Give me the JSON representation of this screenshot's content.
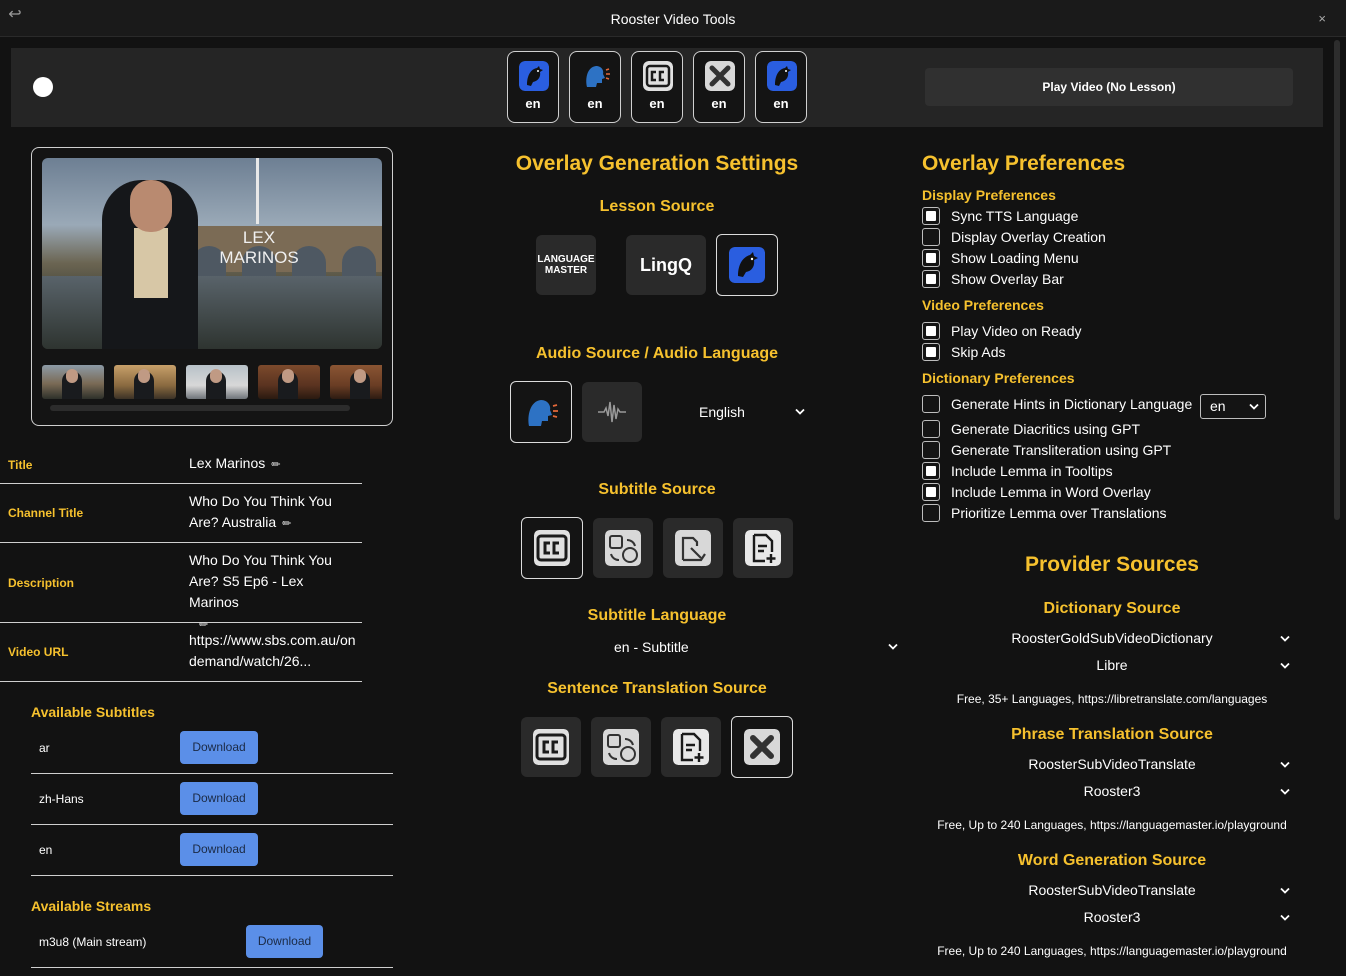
{
  "window": {
    "title": "Rooster Video Tools",
    "back_icon": "↩",
    "close_icon": "×"
  },
  "toolbar": {
    "buttons": [
      {
        "icon": "rooster-icon",
        "label": "en"
      },
      {
        "icon": "speaking-head-icon",
        "label": "en"
      },
      {
        "icon": "closed-captions-icon",
        "label": "en"
      },
      {
        "icon": "close-x-icon",
        "label": "en"
      },
      {
        "icon": "rooster-icon",
        "label": "en"
      }
    ],
    "play_label": "Play Video (No Lesson)"
  },
  "video": {
    "caption_line1": "LEX",
    "caption_line2": "MARINOS"
  },
  "metadata": [
    {
      "key": "Title",
      "value": "Lex Marinos"
    },
    {
      "key": "Channel Title",
      "value": "Who Do You Think You Are? Australia"
    },
    {
      "key": "Description",
      "value": "Who Do You Think You Are? S5 Ep6 - Lex Marinos"
    },
    {
      "key": "Video URL",
      "value": "https://www.sbs.com.au/ondemand/watch/26..."
    }
  ],
  "subtitles": {
    "heading": "Available Subtitles",
    "items": [
      {
        "lang": "ar",
        "button": "Download"
      },
      {
        "lang": "zh-Hans",
        "button": "Download"
      },
      {
        "lang": "en",
        "button": "Download"
      }
    ]
  },
  "streams": {
    "heading": "Available Streams",
    "items": [
      {
        "name": "m3u8 (Main stream)",
        "button": "Download"
      }
    ]
  },
  "overlay_settings": {
    "title": "Overlay Generation Settings",
    "lesson_source": {
      "heading": "Lesson Source",
      "language_master_line1": "LANGUAGE",
      "language_master_line2": "MASTER",
      "lingq": "LingQ"
    },
    "audio": {
      "heading": "Audio Source / Audio Language",
      "language": "English"
    },
    "subtitle_source": {
      "heading": "Subtitle Source"
    },
    "subtitle_language": {
      "heading": "Subtitle Language",
      "value": "en - Subtitle"
    },
    "sentence_translation": {
      "heading": "Sentence Translation Source"
    }
  },
  "overlay_prefs": {
    "title": "Overlay Preferences",
    "display": {
      "heading": "Display Preferences",
      "items": [
        {
          "label": "Sync TTS Language",
          "checked": true
        },
        {
          "label": "Display Overlay Creation",
          "checked": false
        },
        {
          "label": "Show Loading Menu",
          "checked": true
        },
        {
          "label": "Show Overlay Bar",
          "checked": true
        }
      ]
    },
    "video": {
      "heading": "Video Preferences",
      "items": [
        {
          "label": "Play Video on Ready",
          "checked": true
        },
        {
          "label": "Skip Ads",
          "checked": true
        }
      ]
    },
    "dictionary": {
      "heading": "Dictionary Preferences",
      "hint_lang": "en",
      "items": [
        {
          "label": "Generate Hints in Dictionary Language",
          "checked": false
        },
        {
          "label": "Generate Diacritics using GPT",
          "checked": false
        },
        {
          "label": "Generate Transliteration using GPT",
          "checked": false
        },
        {
          "label": "Include Lemma in Tooltips",
          "checked": true
        },
        {
          "label": "Include Lemma in Word Overlay",
          "checked": true
        },
        {
          "label": "Prioritize Lemma over Translations",
          "checked": false
        }
      ]
    }
  },
  "providers": {
    "title": "Provider Sources",
    "dictionary": {
      "heading": "Dictionary Source",
      "primary": "RoosterGoldSubVideoDictionary",
      "secondary": "Libre",
      "note": "Free, 35+ Languages, https://libretranslate.com/languages"
    },
    "phrase": {
      "heading": "Phrase Translation Source",
      "primary": "RoosterSubVideoTranslate",
      "secondary": "Rooster3",
      "note": "Free, Up to 240 Languages, https://languagemaster.io/playground"
    },
    "word": {
      "heading": "Word Generation Source",
      "primary": "RoosterSubVideoTranslate",
      "secondary": "Rooster3",
      "note": "Free, Up to 240 Languages, https://languagemaster.io/playground"
    }
  },
  "colors": {
    "accent": "#f6c12e",
    "button_blue": "#5b8fe8",
    "rooster_blue": "#2a5ee0"
  }
}
